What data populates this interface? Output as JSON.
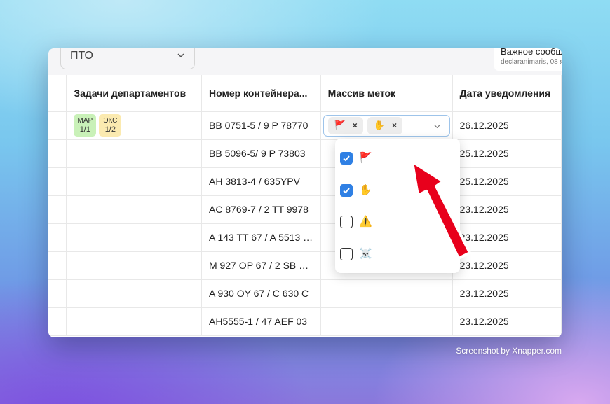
{
  "header": {
    "department_select": {
      "value": "ПТО"
    },
    "notification": {
      "title": "Важное сообщ",
      "meta": "declaranimaris, 08 я"
    }
  },
  "table": {
    "columns": [
      "",
      "Задачи департаментов",
      "Номер контейнера...",
      "Массив меток",
      "Дата уведомления"
    ],
    "rows": [
      {
        "tasks": [
          {
            "code": "МАР",
            "count": "1/1",
            "color": "#c9f1b8"
          },
          {
            "code": "ЭКС",
            "count": "1/2",
            "color": "#fbeab0"
          }
        ],
        "container": "BB 0751-5 / 9 P 78770",
        "date": "26.12.2025"
      },
      {
        "tasks": [],
        "container": "BB 5096-5/ 9 P 73803",
        "date": "25.12.2025"
      },
      {
        "tasks": [],
        "container": "AH 3813-4 / 635YPV",
        "date": "25.12.2025"
      },
      {
        "tasks": [],
        "container": "AC 8769-7 / 2 TT 9978",
        "date": "23.12.2025"
      },
      {
        "tasks": [],
        "container": "A 143 TT 67 / A 5513 …",
        "date": "23.12.2025"
      },
      {
        "tasks": [],
        "container": "M 927 OP 67 / 2 SB …",
        "date": "23.12.2025"
      },
      {
        "tasks": [],
        "container": "A 930 OY 67 / C 630 C",
        "date": "23.12.2025"
      },
      {
        "tasks": [],
        "container": "AH5555-1 / 47 AEF 03",
        "date": "23.12.2025"
      }
    ]
  },
  "tag_select": {
    "selected": [
      {
        "emoji": "🚩",
        "icon": "red-flag-icon"
      },
      {
        "emoji": "✋",
        "icon": "raised-hand-icon"
      }
    ],
    "remove_glyph": "×"
  },
  "tag_options": [
    {
      "emoji": "🚩",
      "icon": "red-flag-icon",
      "checked": true
    },
    {
      "emoji": "✋",
      "icon": "raised-hand-icon",
      "checked": true
    },
    {
      "emoji": "⚠️",
      "icon": "warning-icon",
      "checked": false
    },
    {
      "emoji": "☠️",
      "icon": "skull-crossbones-icon",
      "checked": false
    }
  ],
  "colors": {
    "accent": "#2f80e4",
    "annotation_arrow": "#e8001c",
    "badge_green": "#c9f1b8",
    "badge_yellow": "#fbeab0"
  },
  "watermark": "Screenshot by Xnapper.com"
}
